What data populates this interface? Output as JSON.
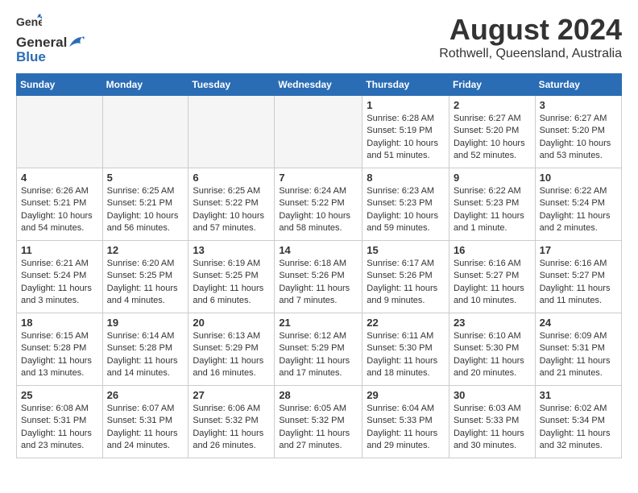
{
  "header": {
    "logo_general": "General",
    "logo_blue": "Blue",
    "month_year": "August 2024",
    "location": "Rothwell, Queensland, Australia"
  },
  "weekdays": [
    "Sunday",
    "Monday",
    "Tuesday",
    "Wednesday",
    "Thursday",
    "Friday",
    "Saturday"
  ],
  "weeks": [
    [
      {
        "day": "",
        "info": ""
      },
      {
        "day": "",
        "info": ""
      },
      {
        "day": "",
        "info": ""
      },
      {
        "day": "",
        "info": ""
      },
      {
        "day": "1",
        "info": "Sunrise: 6:28 AM\nSunset: 5:19 PM\nDaylight: 10 hours\nand 51 minutes."
      },
      {
        "day": "2",
        "info": "Sunrise: 6:27 AM\nSunset: 5:20 PM\nDaylight: 10 hours\nand 52 minutes."
      },
      {
        "day": "3",
        "info": "Sunrise: 6:27 AM\nSunset: 5:20 PM\nDaylight: 10 hours\nand 53 minutes."
      }
    ],
    [
      {
        "day": "4",
        "info": "Sunrise: 6:26 AM\nSunset: 5:21 PM\nDaylight: 10 hours\nand 54 minutes."
      },
      {
        "day": "5",
        "info": "Sunrise: 6:25 AM\nSunset: 5:21 PM\nDaylight: 10 hours\nand 56 minutes."
      },
      {
        "day": "6",
        "info": "Sunrise: 6:25 AM\nSunset: 5:22 PM\nDaylight: 10 hours\nand 57 minutes."
      },
      {
        "day": "7",
        "info": "Sunrise: 6:24 AM\nSunset: 5:22 PM\nDaylight: 10 hours\nand 58 minutes."
      },
      {
        "day": "8",
        "info": "Sunrise: 6:23 AM\nSunset: 5:23 PM\nDaylight: 10 hours\nand 59 minutes."
      },
      {
        "day": "9",
        "info": "Sunrise: 6:22 AM\nSunset: 5:23 PM\nDaylight: 11 hours\nand 1 minute."
      },
      {
        "day": "10",
        "info": "Sunrise: 6:22 AM\nSunset: 5:24 PM\nDaylight: 11 hours\nand 2 minutes."
      }
    ],
    [
      {
        "day": "11",
        "info": "Sunrise: 6:21 AM\nSunset: 5:24 PM\nDaylight: 11 hours\nand 3 minutes."
      },
      {
        "day": "12",
        "info": "Sunrise: 6:20 AM\nSunset: 5:25 PM\nDaylight: 11 hours\nand 4 minutes."
      },
      {
        "day": "13",
        "info": "Sunrise: 6:19 AM\nSunset: 5:25 PM\nDaylight: 11 hours\nand 6 minutes."
      },
      {
        "day": "14",
        "info": "Sunrise: 6:18 AM\nSunset: 5:26 PM\nDaylight: 11 hours\nand 7 minutes."
      },
      {
        "day": "15",
        "info": "Sunrise: 6:17 AM\nSunset: 5:26 PM\nDaylight: 11 hours\nand 9 minutes."
      },
      {
        "day": "16",
        "info": "Sunrise: 6:16 AM\nSunset: 5:27 PM\nDaylight: 11 hours\nand 10 minutes."
      },
      {
        "day": "17",
        "info": "Sunrise: 6:16 AM\nSunset: 5:27 PM\nDaylight: 11 hours\nand 11 minutes."
      }
    ],
    [
      {
        "day": "18",
        "info": "Sunrise: 6:15 AM\nSunset: 5:28 PM\nDaylight: 11 hours\nand 13 minutes."
      },
      {
        "day": "19",
        "info": "Sunrise: 6:14 AM\nSunset: 5:28 PM\nDaylight: 11 hours\nand 14 minutes."
      },
      {
        "day": "20",
        "info": "Sunrise: 6:13 AM\nSunset: 5:29 PM\nDaylight: 11 hours\nand 16 minutes."
      },
      {
        "day": "21",
        "info": "Sunrise: 6:12 AM\nSunset: 5:29 PM\nDaylight: 11 hours\nand 17 minutes."
      },
      {
        "day": "22",
        "info": "Sunrise: 6:11 AM\nSunset: 5:30 PM\nDaylight: 11 hours\nand 18 minutes."
      },
      {
        "day": "23",
        "info": "Sunrise: 6:10 AM\nSunset: 5:30 PM\nDaylight: 11 hours\nand 20 minutes."
      },
      {
        "day": "24",
        "info": "Sunrise: 6:09 AM\nSunset: 5:31 PM\nDaylight: 11 hours\nand 21 minutes."
      }
    ],
    [
      {
        "day": "25",
        "info": "Sunrise: 6:08 AM\nSunset: 5:31 PM\nDaylight: 11 hours\nand 23 minutes."
      },
      {
        "day": "26",
        "info": "Sunrise: 6:07 AM\nSunset: 5:31 PM\nDaylight: 11 hours\nand 24 minutes."
      },
      {
        "day": "27",
        "info": "Sunrise: 6:06 AM\nSunset: 5:32 PM\nDaylight: 11 hours\nand 26 minutes."
      },
      {
        "day": "28",
        "info": "Sunrise: 6:05 AM\nSunset: 5:32 PM\nDaylight: 11 hours\nand 27 minutes."
      },
      {
        "day": "29",
        "info": "Sunrise: 6:04 AM\nSunset: 5:33 PM\nDaylight: 11 hours\nand 29 minutes."
      },
      {
        "day": "30",
        "info": "Sunrise: 6:03 AM\nSunset: 5:33 PM\nDaylight: 11 hours\nand 30 minutes."
      },
      {
        "day": "31",
        "info": "Sunrise: 6:02 AM\nSunset: 5:34 PM\nDaylight: 11 hours\nand 32 minutes."
      }
    ]
  ]
}
